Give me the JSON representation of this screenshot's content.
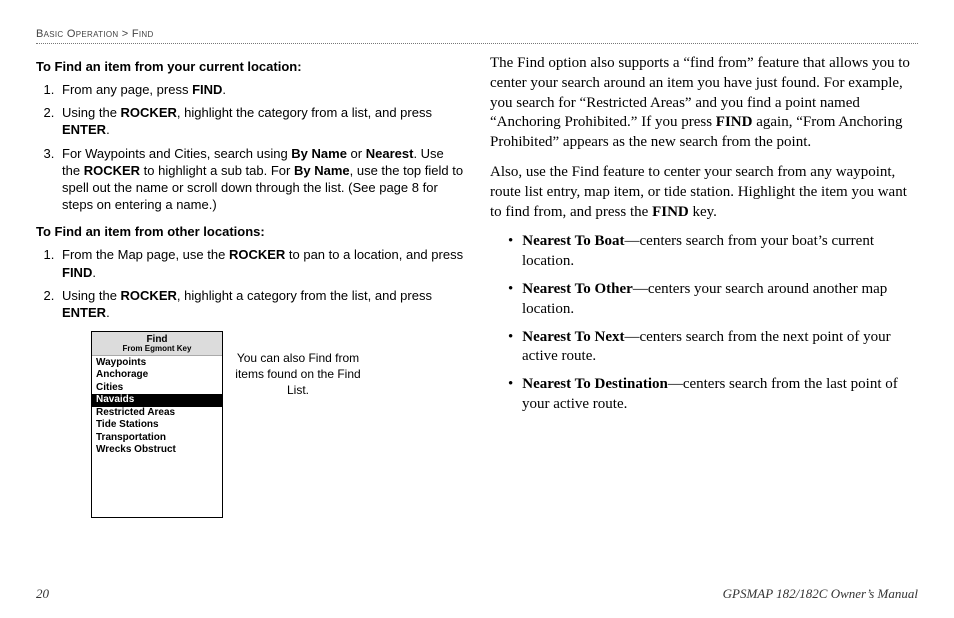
{
  "breadcrumb": {
    "section": "Basic Operation",
    "sep": " > ",
    "sub": "Find"
  },
  "left": {
    "h1": "To Find an item from your current location:",
    "s1": [
      {
        "pre": "From any page, press ",
        "b1": "FIND",
        "post": "."
      },
      {
        "pre": "Using the ",
        "b1": "ROCKER",
        "mid": ", highlight the category from a list, and press ",
        "b2": "ENTER",
        "post": "."
      },
      {
        "pre": "For Waypoints and Cities, search using ",
        "b1": "By Name",
        "mid": " or ",
        "b2": "Nearest",
        "mid2": ". Use the ",
        "b3": "ROCKER",
        "mid3": " to highlight a sub tab. For ",
        "b4": "By Name",
        "post": ", use the top field to spell out the name or scroll down through the list. (See page 8 for steps on entering a name.)"
      }
    ],
    "h2": "To Find an item from other locations:",
    "s2": [
      {
        "pre": "From the Map page, use the ",
        "b1": "ROCKER",
        "mid": " to pan to a location, and press ",
        "b2": "FIND",
        "post": "."
      },
      {
        "pre": "Using the ",
        "b1": "ROCKER",
        "mid": ", highlight a category from the list, and press ",
        "b2": "ENTER",
        "post": "."
      }
    ],
    "find": {
      "title": "Find",
      "sub": "From Egmont Key",
      "items": [
        "Waypoints",
        "Anchorage",
        "Cities",
        "Navaids",
        "Restricted Areas",
        "Tide Stations",
        "Transportation",
        "Wrecks Obstruct"
      ],
      "selectedIndex": 3,
      "caption": "You can also Find from items found on the Find List."
    }
  },
  "right": {
    "p1a": "The Find option also supports a “find from” feature that allows you to center your search around an item you have just found. For example, you search for “Restricted Areas” and you find a point named “Anchoring Prohibited.” If you press ",
    "p1b": "FIND",
    "p1c": " again, “From Anchoring Prohibited” appears as the new search from the point.",
    "p2a": "Also, use the Find feature to center your search from any waypoint, route list entry, map item, or tide station. Highlight the item you want to find from, and press the ",
    "p2b": "FIND",
    "p2c": " key.",
    "bullets": [
      {
        "b": "Nearest To Boat",
        "t": "—centers search from your boat’s current location."
      },
      {
        "b": "Nearest To Other",
        "t": "—centers your search around another map location."
      },
      {
        "b": "Nearest To Next",
        "t": "—centers search from the next point of your active route."
      },
      {
        "b": "Nearest To Destination",
        "t": "—centers search from the last point of your active route."
      }
    ]
  },
  "footer": {
    "page": "20",
    "book": "GPSMAP 182/182C Owner’s Manual"
  }
}
